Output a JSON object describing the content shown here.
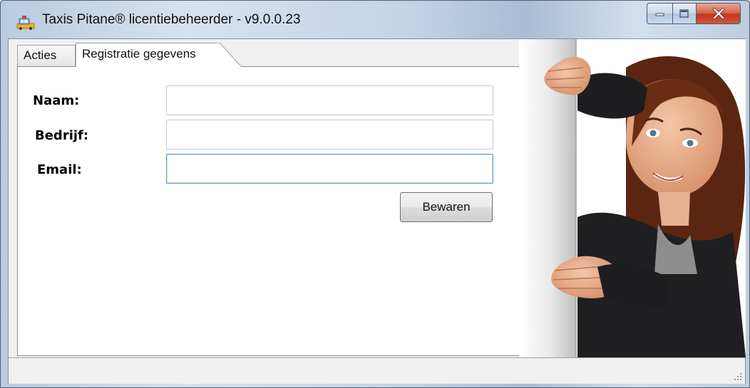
{
  "window": {
    "title": "Taxis Pitane® licentiebeheerder - v9.0.0.23"
  },
  "tabs": [
    {
      "label": "Acties"
    },
    {
      "label": "Registratie gegevens"
    }
  ],
  "form": {
    "name_label": "Naam:",
    "company_label": "Bedrijf:",
    "email_label": "Email:",
    "name_value": "",
    "company_value": "",
    "email_value": "",
    "save_label": "Bewaren"
  },
  "icons": {
    "app": "app-icon",
    "minimize": "minimize-icon",
    "maximize": "maximize-icon",
    "close": "close-icon",
    "grip": "resize-grip-icon"
  },
  "colors": {
    "focus_border": "#5b9bd5",
    "close_button": "#c2381c"
  }
}
